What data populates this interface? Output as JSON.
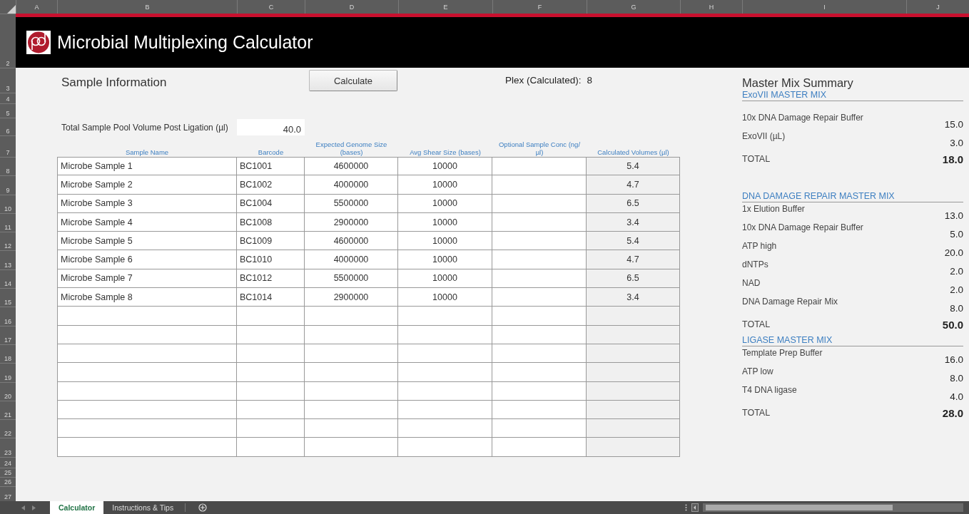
{
  "column_headers": [
    "A",
    "B",
    "C",
    "D",
    "E",
    "F",
    "G",
    "H",
    "I",
    "J"
  ],
  "row_headers": [
    "2",
    "3",
    "4",
    "5",
    "6",
    "7",
    "8",
    "9",
    "10",
    "11",
    "12",
    "13",
    "14",
    "15",
    "16",
    "17",
    "18",
    "19",
    "20",
    "21",
    "22",
    "23",
    "24",
    "25",
    "26",
    "27"
  ],
  "title": "Microbial Multiplexing Calculator",
  "sample_info": {
    "heading": "Sample Information",
    "calculate_button": "Calculate",
    "plex_label": "Plex (Calculated):",
    "plex_value": "8",
    "pool_volume_label": "Total Sample Pool Volume Post Ligation (µl)",
    "pool_volume_value": "40.0"
  },
  "table": {
    "columns": [
      {
        "label": "Sample Name",
        "shaded": false
      },
      {
        "label": "Barcode",
        "shaded": false
      },
      {
        "label": "Expected Genome Size (bases)",
        "shaded": false
      },
      {
        "label": "Avg Shear Size (bases)",
        "shaded": false
      },
      {
        "label": "Optional Sample Conc (ng/µl)",
        "shaded": false
      },
      {
        "label": "Calculated Volumes (µl)",
        "shaded": true
      }
    ],
    "rows": [
      {
        "name": "Microbe Sample 1",
        "barcode": "BC1001",
        "genome_size": "4600000",
        "shear_size": "10000",
        "volume": "5.4"
      },
      {
        "name": "Microbe Sample 2",
        "barcode": "BC1002",
        "genome_size": "4000000",
        "shear_size": "10000",
        "volume": "4.7"
      },
      {
        "name": "Microbe Sample 3",
        "barcode": "BC1004",
        "genome_size": "5500000",
        "shear_size": "10000",
        "volume": "6.5"
      },
      {
        "name": "Microbe Sample 4",
        "barcode": "BC1008",
        "genome_size": "2900000",
        "shear_size": "10000",
        "volume": "3.4"
      },
      {
        "name": "Microbe Sample 5",
        "barcode": "BC1009",
        "genome_size": "4600000",
        "shear_size": "10000",
        "volume": "5.4"
      },
      {
        "name": "Microbe Sample 6",
        "barcode": "BC1010",
        "genome_size": "4000000",
        "shear_size": "10000",
        "volume": "4.7"
      },
      {
        "name": "Microbe Sample 7",
        "barcode": "BC1012",
        "genome_size": "5500000",
        "shear_size": "10000",
        "volume": "6.5"
      },
      {
        "name": "Microbe Sample 8",
        "barcode": "BC1014",
        "genome_size": "2900000",
        "shear_size": "10000",
        "volume": "3.4"
      }
    ]
  },
  "master_mix": {
    "title": "Master Mix Summary",
    "sections": [
      {
        "heading": "ExoVII MASTER MIX",
        "items": [
          {
            "label": "10x DNA Damage Repair Buffer",
            "value": "15.0"
          },
          {
            "label": "ExoVII (µL)",
            "value": "3.0"
          }
        ],
        "total": {
          "label": "TOTAL",
          "value": "18.0"
        }
      },
      {
        "heading": "DNA DAMAGE REPAIR MASTER MIX",
        "items": [
          {
            "label": "1x Elution Buffer",
            "value": "13.0"
          },
          {
            "label": "10x DNA Damage Repair Buffer",
            "value": "5.0"
          },
          {
            "label": "ATP high",
            "value": "20.0"
          },
          {
            "label": "dNTPs",
            "value": "2.0"
          },
          {
            "label": "NAD",
            "value": "2.0"
          },
          {
            "label": "DNA Damage Repair Mix",
            "value": "8.0"
          }
        ],
        "total": {
          "label": "TOTAL",
          "value": "50.0"
        }
      },
      {
        "heading": "LIGASE MASTER MIX",
        "items": [
          {
            "label": "Template Prep Buffer",
            "value": "16.0"
          },
          {
            "label": "ATP low",
            "value": "8.0"
          },
          {
            "label": "T4 DNA ligase",
            "value": "4.0"
          }
        ],
        "total": {
          "label": "TOTAL",
          "value": "28.0"
        }
      }
    ]
  },
  "sheet_tabs": [
    {
      "label": "Calculator",
      "selected": true
    },
    {
      "label": "Instructions & Tips",
      "selected": false
    }
  ]
}
